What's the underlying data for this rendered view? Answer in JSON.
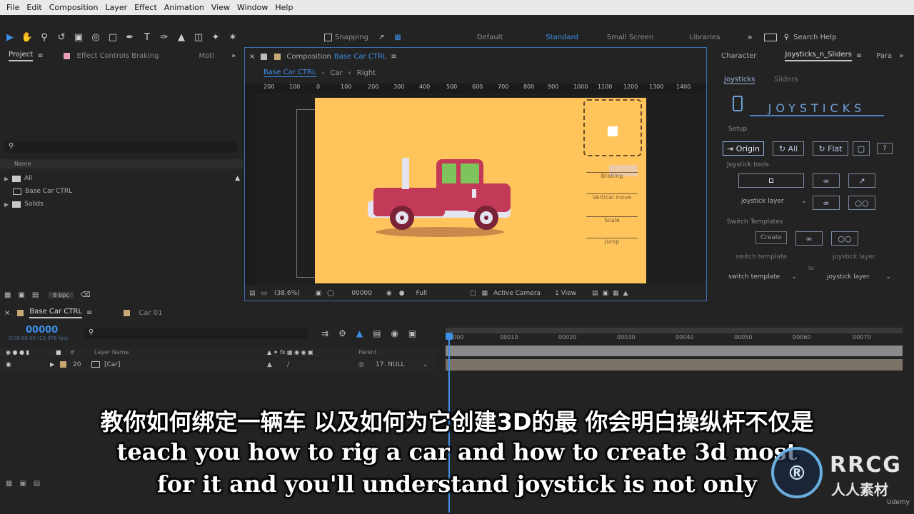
{
  "menu": [
    "File",
    "Edit",
    "Composition",
    "Layer",
    "Effect",
    "Animation",
    "View",
    "Window",
    "Help"
  ],
  "toolbar": {
    "snapping": "Snapping",
    "workspaces": [
      "Default",
      "Standard",
      "Small Screen",
      "Libraries"
    ],
    "search_help": "Search Help"
  },
  "project": {
    "tab_project": "Project",
    "tab_effect_controls": "Effect Controls Braking",
    "tab_more": "Moti",
    "col_name": "Name",
    "items": [
      "All",
      "Base Car CTRL",
      "Solids"
    ],
    "bpc": "8 bpc",
    "search_placeholder": ""
  },
  "composition": {
    "tab_prefix": "Composition",
    "tab_name": "Base Car CTRL",
    "breadcrumbs": [
      "Base Car CTRL",
      "Car",
      "Right"
    ],
    "ruler_ticks": [
      "200",
      "100",
      "0",
      "100",
      "200",
      "300",
      "400",
      "500",
      "600",
      "700",
      "800",
      "900",
      "1000",
      "1100",
      "1200",
      "1300",
      "1400"
    ],
    "zoom": "(38.6%)",
    "timecode": "00000",
    "resolution": "Full",
    "camera": "Active Camera",
    "views": "1 View",
    "sliders": [
      "Braking",
      "Vertical move",
      "Scale",
      "Jump"
    ],
    "accent": "#ffc55c"
  },
  "right_panel": {
    "tabs": [
      "Character",
      "Joysticks_n_Sliders",
      "Para"
    ],
    "subtabs": [
      "Joysticks",
      "Sliders"
    ],
    "logo_text": "JOYSTICKS",
    "setup_label": "Setup",
    "setup_buttons": [
      "Origin",
      "All",
      "Flat",
      "?"
    ],
    "joystick_tools_label": "Joystick tools",
    "joystick_layer": "joystick layer",
    "switch_templates_label": "Switch Templates",
    "create": "Create",
    "switch_template": "switch template",
    "joystick_layer_label": "joystick layer",
    "to": "to",
    "switch_template_select": "switch template",
    "joystick_layer_select": "joystick layer"
  },
  "timeline": {
    "tabs": [
      "Base Car CTRL",
      "Car 01"
    ],
    "timecode": "00000",
    "fps": "0:00:00:00 (23.976 fps)",
    "col_layer_name": "Layer Name",
    "col_parent": "Parent",
    "layer_num": "20",
    "layer_name": "[Car]",
    "parent": "17. NULL",
    "ticks": [
      "00000",
      "00010",
      "00020",
      "00030",
      "00040",
      "00050",
      "00060",
      "00070"
    ]
  },
  "subtitles": {
    "zh": "教你如何绑定一辆车 以及如何为它创建3D的最 你会明白操纵杆不仅是",
    "en1": "teach you how to rig a car and how to create 3d most",
    "en2": "for it and you'll understand joystick is not only"
  },
  "watermark": {
    "brand": "RRCG",
    "cn": "人人素材",
    "udemy": "Udemy"
  }
}
